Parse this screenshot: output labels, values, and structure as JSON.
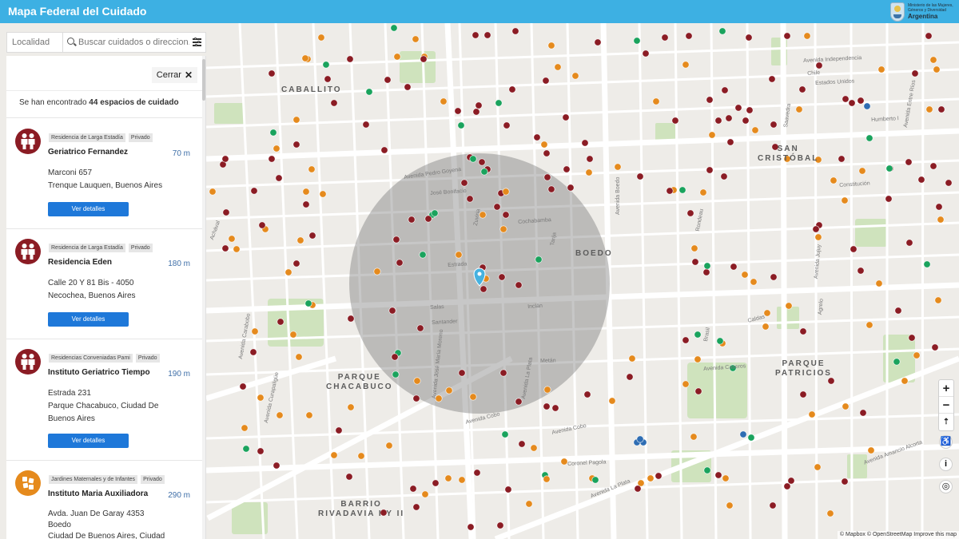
{
  "header": {
    "title": "Mapa Federal del Cuidado",
    "gov_line1": "Ministerio de las Mujeres,",
    "gov_line2": "Géneros y Diversidad",
    "gov_country": "Argentina"
  },
  "search": {
    "locality_placeholder": "Localidad",
    "query_placeholder": "Buscar cuidados o direccion..."
  },
  "panel": {
    "close_label": "Cerrar",
    "results_prefix": "Se han encontrado",
    "results_count": "44 espacios de cuidado",
    "details_label": "Ver detalles",
    "cards": [
      {
        "tags": [
          "Residencia de Larga Estadía",
          "Privado"
        ],
        "name": "Geriatrico Fernandez",
        "distance": "70 m",
        "address1": "Marconi 657",
        "address2": "Trenque Lauquen, Buenos Aires"
      },
      {
        "tags": [
          "Residencia de Larga Estadía",
          "Privado"
        ],
        "name": "Residencia Eden",
        "distance": "180 m",
        "address1": "Calle 20 Y 81 Bis - 4050",
        "address2": "Necochea, Buenos Aires"
      },
      {
        "tags": [
          "Residencias Conveniadas Pami",
          "Privado"
        ],
        "name": "Instituto Geriatrico Tiempo",
        "distance": "190 m",
        "address1": "Estrada 231",
        "address2": "Parque Chacabuco, Ciudad De Buenos Aires"
      },
      {
        "tags": [
          "Jardines Maternales y de Infantes",
          "Privado"
        ],
        "name": "Instituto Maria Auxiliadora",
        "distance": "290 m",
        "address1": "Avda. Juan De Garay 4353",
        "address2": "Boedo",
        "address3": "Ciudad De Buenos Aires, Ciudad"
      }
    ]
  },
  "map": {
    "neighborhoods": [
      {
        "id": "caballito",
        "label": "CABALLITO"
      },
      {
        "id": "boedo",
        "label": "BOEDO"
      },
      {
        "id": "san-cristobal",
        "label": "SAN\nCRISTÓBAL"
      },
      {
        "id": "parque-chacabuco",
        "label": "PARQUE\nCHACABUCO"
      },
      {
        "id": "parque-patricios",
        "label": "PARQUE\nPATRICIOS"
      },
      {
        "id": "barrio-rivadavia",
        "label": "BARRIO\nRIVADAVIA I Y II"
      }
    ],
    "streets": [
      "Avenida Pedro Goyena",
      "José Bonifacio",
      "Cochabamba",
      "Zuviria",
      "Tarija",
      "Estrada",
      "Avenida Carabobo",
      "Avenida Boedo",
      "Avenida La Plata",
      "Avenida Caseros",
      "Avenida Cobo",
      "Avenida Independencia",
      "Avenida Entre Ríos",
      "Santander",
      "Inclán",
      "Metán",
      "Avenida José María Moreno",
      "Avenida Curapaligüe",
      "Avenida Amancio Alcorta",
      "Coronel Pagola",
      "Chile",
      "Estados Unidos",
      "Constitución",
      "Saavedra",
      "Rondeau",
      "Brasil",
      "Avenida Cobo",
      "Avenida La Plata",
      "Humberto I",
      "Salas",
      "Achával",
      "Avenida Jujuy",
      "Agrelo",
      "Caldas"
    ],
    "zoom_in": "+",
    "zoom_out": "−",
    "compass": "⇡",
    "accessibility": "♿",
    "info": "i",
    "locate": "◎",
    "attribution": "© Mapbox © OpenStreetMap Improve this map",
    "colors": {
      "residence": "#8b1c24",
      "kindergarten": "#e58a1d",
      "other": "#1aa35d",
      "blue": "#2e6db3",
      "pin": "#46b2e0"
    }
  }
}
